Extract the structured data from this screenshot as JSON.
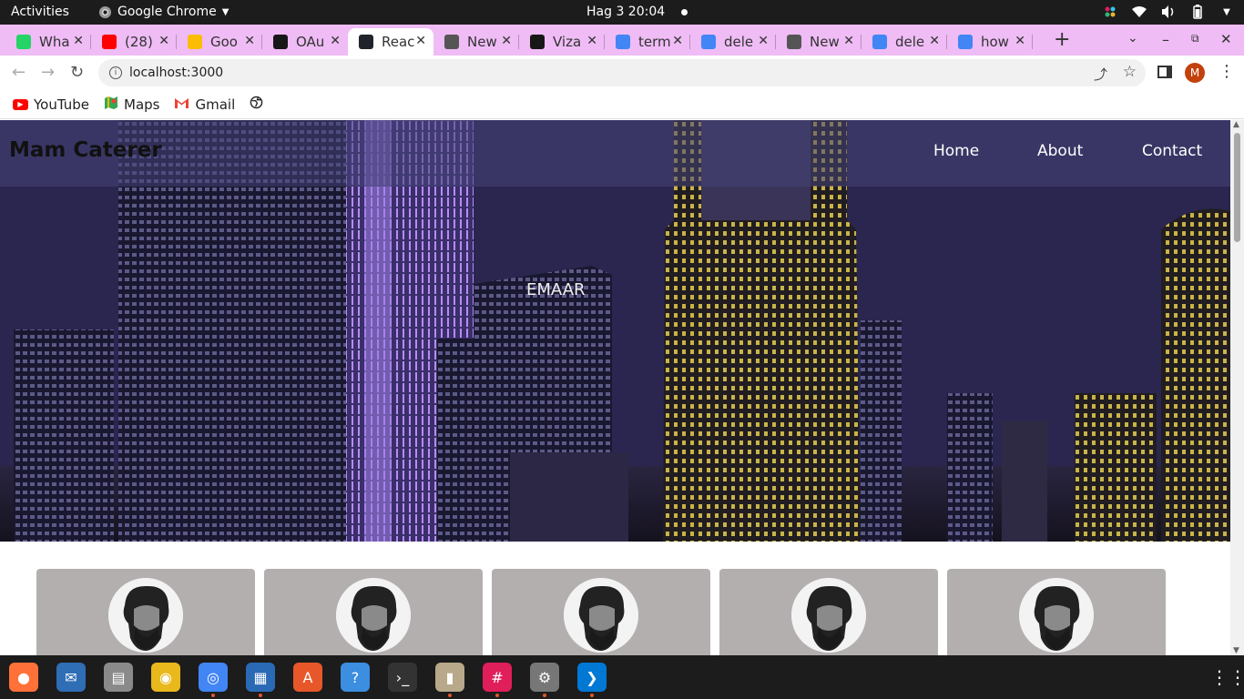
{
  "topbar": {
    "activities": "Activities",
    "app_name": "Google Chrome",
    "clock": "Hag 3  20:04"
  },
  "tabs": [
    {
      "label": "Wha",
      "icon": "whatsapp-icon",
      "color": "#25d366"
    },
    {
      "label": "(28)",
      "icon": "youtube-icon",
      "color": "#ff0000"
    },
    {
      "label": "Goo",
      "icon": "google-drive-icon",
      "color": "#fbbc04"
    },
    {
      "label": "OAu",
      "icon": "github-icon",
      "color": "#181717"
    },
    {
      "label": "Reac",
      "icon": "react-icon",
      "color": "#20232a"
    },
    {
      "label": "New",
      "icon": "chrome-icon",
      "color": "#555555"
    },
    {
      "label": "Viza",
      "icon": "github-icon",
      "color": "#181717"
    },
    {
      "label": "term",
      "icon": "google-icon",
      "color": "#4285f4"
    },
    {
      "label": "dele",
      "icon": "google-icon",
      "color": "#4285f4"
    },
    {
      "label": "New",
      "icon": "chrome-icon",
      "color": "#555555"
    },
    {
      "label": "dele",
      "icon": "google-icon",
      "color": "#4285f4"
    },
    {
      "label": "how",
      "icon": "google-icon",
      "color": "#4285f4"
    }
  ],
  "active_tab_index": 4,
  "address_bar": {
    "url": "localhost:3000"
  },
  "profile": {
    "initial": "M"
  },
  "bookmarks": [
    {
      "label": "YouTube",
      "icon": "youtube-icon",
      "color": "#ff0000"
    },
    {
      "label": "Maps",
      "icon": "maps-icon",
      "color": "#34a853"
    },
    {
      "label": "Gmail",
      "icon": "gmail-icon",
      "color": "#ea4335"
    }
  ],
  "page": {
    "brand": "Mam Caterer",
    "nav": [
      "Home",
      "About",
      "Contact"
    ],
    "hero_sign": "EMAAR",
    "card_count": 5
  },
  "dock": [
    {
      "name": "firefox-icon",
      "color": "#ff7139",
      "glyph": "●",
      "running": false
    },
    {
      "name": "thunderbird-icon",
      "color": "#2f6db5",
      "glyph": "✉",
      "running": false
    },
    {
      "name": "files-icon",
      "color": "#8a8a8a",
      "glyph": "▤",
      "running": false
    },
    {
      "name": "rhythmbox-icon",
      "color": "#e8b81c",
      "glyph": "◉",
      "running": false
    },
    {
      "name": "chrome-icon",
      "color": "#4285f4",
      "glyph": "◎",
      "running": true
    },
    {
      "name": "writer-icon",
      "color": "#2a6ab5",
      "glyph": "▦",
      "running": true
    },
    {
      "name": "software-icon",
      "color": "#e8572a",
      "glyph": "A",
      "running": false
    },
    {
      "name": "help-icon",
      "color": "#3b8ee0",
      "glyph": "?",
      "running": false
    },
    {
      "name": "terminal-icon",
      "color": "#333333",
      "glyph": "›_",
      "running": false
    },
    {
      "name": "archive-icon",
      "color": "#b8a98a",
      "glyph": "▮",
      "running": true
    },
    {
      "name": "slack-icon",
      "color": "#e01e5a",
      "glyph": "#",
      "running": true
    },
    {
      "name": "settings-icon",
      "color": "#777777",
      "glyph": "⚙",
      "running": true
    },
    {
      "name": "vscode-icon",
      "color": "#0078d4",
      "glyph": "❯",
      "running": true
    }
  ]
}
